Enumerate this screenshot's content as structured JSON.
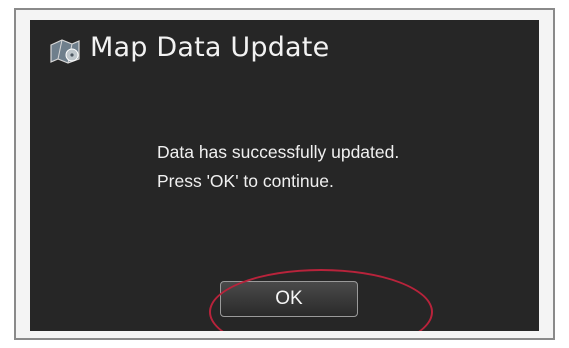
{
  "dialog": {
    "title": "Map Data Update",
    "title_icon": "map-disc-icon",
    "message_line1": "Data has successfully updated.",
    "message_line2": "Press 'OK' to continue.",
    "ok_label": "OK"
  },
  "colors": {
    "screen_background": "#262626",
    "text": "#f0f0f0",
    "highlight_ring": "#b8233b"
  }
}
